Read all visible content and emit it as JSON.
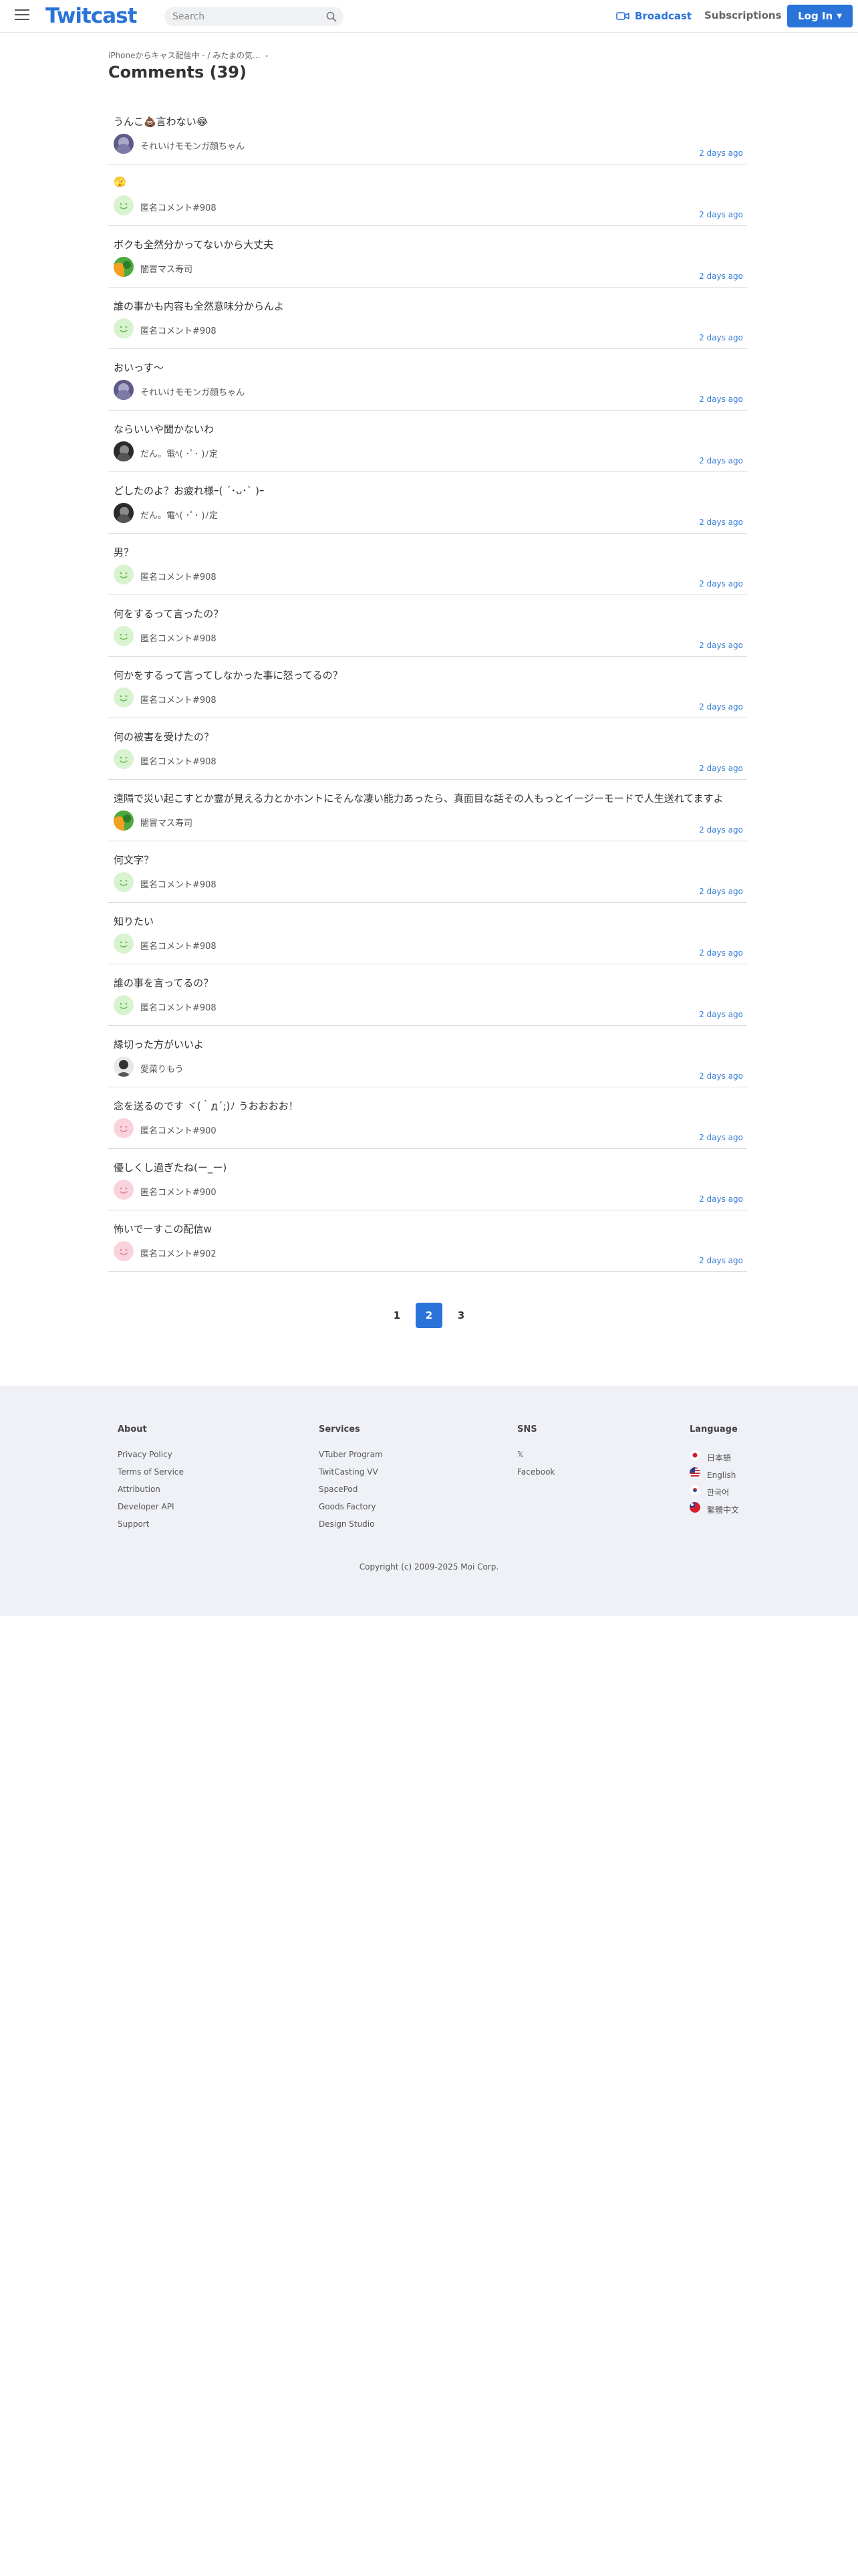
{
  "header": {
    "logo": "Twitcast",
    "search_placeholder": "Search",
    "broadcast": "Broadcast",
    "subscriptions": "Subscriptions",
    "login": "Log In"
  },
  "breadcrumb": "iPhoneからキャス配信中 - / みたまの気...",
  "page_title": "Comments (39)",
  "comments": [
    {
      "text": "うんこ💩言わない😂",
      "author": "それいけモモンガ顔ちゃん",
      "time": "2 days ago",
      "avatar": "photo-purple"
    },
    {
      "text": "🫣",
      "author": "匿名コメント#908",
      "time": "2 days ago",
      "avatar": "anon-green"
    },
    {
      "text": "ボクも全然分かってないから大丈夫",
      "author": "闇冒マス寿司",
      "time": "2 days ago",
      "avatar": "photo-parrot"
    },
    {
      "text": "誰の事かも内容も全然意味分からんよ",
      "author": "匿名コメント#908",
      "time": "2 days ago",
      "avatar": "anon-green"
    },
    {
      "text": "おいっす〜",
      "author": "それいけモモンガ顔ちゃん",
      "time": "2 days ago",
      "avatar": "photo-purple"
    },
    {
      "text": "ならいいや聞かないわ",
      "author": "だん。電ﾍ(  ･ﾟ･ )ﾉ定",
      "time": "2 days ago",
      "avatar": "photo-dark"
    },
    {
      "text": "どしたのよ？お疲れ様ｰ( ´･ᴗ･` )ｰ",
      "author": "だん。電ﾍ(  ･ﾟ･ )ﾉ定",
      "time": "2 days ago",
      "avatar": "photo-dark"
    },
    {
      "text": "男？",
      "author": "匿名コメント#908",
      "time": "2 days ago",
      "avatar": "anon-green"
    },
    {
      "text": "何をするって言ったの？",
      "author": "匿名コメント#908",
      "time": "2 days ago",
      "avatar": "anon-green"
    },
    {
      "text": "何かをするって言ってしなかった事に怒ってるの？",
      "author": "匿名コメント#908",
      "time": "2 days ago",
      "avatar": "anon-green"
    },
    {
      "text": "何の被害を受けたの？",
      "author": "匿名コメント#908",
      "time": "2 days ago",
      "avatar": "anon-green"
    },
    {
      "text": "遠隔で災い起こすとか霊が見える力とかホントにそんな凄い能力あったら、真面目な話その人もっとイージーモードで人生送れてますよ",
      "author": "闇冒マス寿司",
      "time": "2 days ago",
      "avatar": "photo-parrot"
    },
    {
      "text": "何文字？",
      "author": "匿名コメント#908",
      "time": "2 days ago",
      "avatar": "anon-green"
    },
    {
      "text": "知りたい",
      "author": "匿名コメント#908",
      "time": "2 days ago",
      "avatar": "anon-green"
    },
    {
      "text": "誰の事を言ってるの？",
      "author": "匿名コメント#908",
      "time": "2 days ago",
      "avatar": "anon-green"
    },
    {
      "text": "縁切った方がいいよ",
      "author": "愛菜りもう",
      "time": "2 days ago",
      "avatar": "photo-mono"
    },
    {
      "text": "念を送るのです ヾ(｀д´;)ﾉ うおおおお！",
      "author": "匿名コメント#900",
      "time": "2 days ago",
      "avatar": "anon-pink"
    },
    {
      "text": "優しくし過ぎたね(ー_ー)",
      "author": "匿名コメント#900",
      "time": "2 days ago",
      "avatar": "anon-pink"
    },
    {
      "text": "怖いでーすこの配信w",
      "author": "匿名コメント#902",
      "time": "2 days ago",
      "avatar": "anon-pink"
    }
  ],
  "pagination": {
    "pages": [
      "1",
      "2",
      "3"
    ],
    "active": "2"
  },
  "footer": {
    "about": {
      "title": "About",
      "links": [
        "Privacy Policy",
        "Terms of Service",
        "Attribution",
        "Developer API",
        "Support"
      ]
    },
    "services": {
      "title": "Services",
      "links": [
        "VTuber Program",
        "TwitCasting VV",
        "SpacePod",
        "Goods Factory",
        "Design Studio"
      ]
    },
    "sns": {
      "title": "SNS",
      "links": [
        "𝕏",
        "Facebook"
      ]
    },
    "language": {
      "title": "Language",
      "links": [
        "日本語",
        "English",
        "한국어",
        "繁體中文"
      ]
    },
    "copyright": "Copyright (c) 2009-2025 Moi Corp."
  },
  "colors": {
    "accent": "#2a73d9",
    "footer_bg": "#eff1f6",
    "anon_green": "#d9f2cf",
    "anon_pink": "#f9d3dc"
  }
}
